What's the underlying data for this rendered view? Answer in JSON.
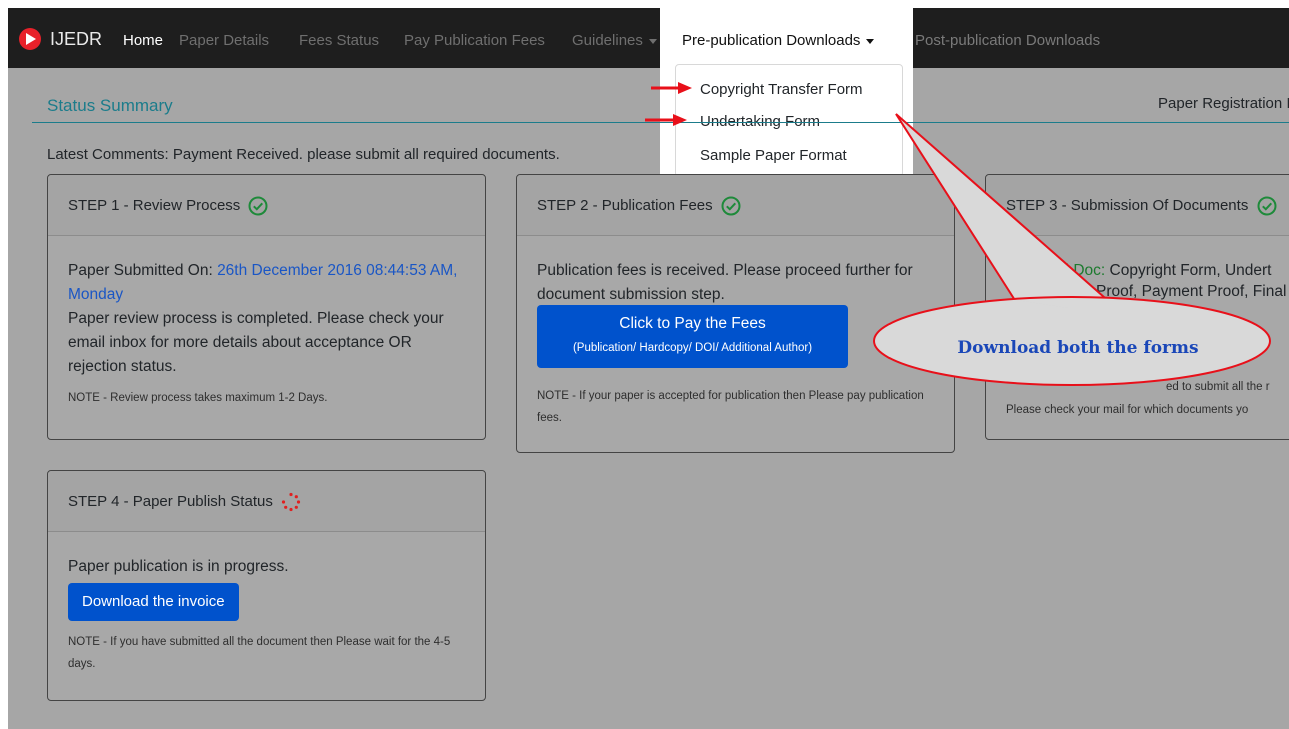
{
  "nav": {
    "brand": "IJEDR",
    "home": "Home",
    "paper_details": "Paper Details",
    "fees_status": "Fees Status",
    "pay_publication_fees": "Pay Publication Fees",
    "guidelines": "Guidelines",
    "pre_publication_downloads": "Pre-publication Downloads",
    "post_publication_downloads": "Post-publication Downloads"
  },
  "dropdown": {
    "items": [
      "Copyright Transfer Form",
      "Undertaking Form",
      "Sample Paper Format"
    ]
  },
  "summary": {
    "title": "Status Summary",
    "registration_label": "Paper Registration I",
    "latest_label": "Latest Comments:",
    "latest_text": "Payment Received. please submit all required documents."
  },
  "steps": {
    "step1": {
      "title": "STEP 1 - Review Process",
      "submitted_label": "Paper Submitted On:",
      "submitted_date": "26th December 2016 08:44:53 AM, Monday",
      "text": "Paper review process is completed. Please check your email inbox for more details about acceptance OR rejection status.",
      "note": "NOTE - Review process takes maximum 1-2 Days."
    },
    "step2": {
      "title": "STEP 2 - Publication Fees",
      "text": "Publication fees is received. Please proceed further for document submission step.",
      "button_line1": "Click to Pay the Fees",
      "button_line2": "(Publication/ Hardcopy/ DOI/ Additional Author)",
      "note": "NOTE - If your paper is accepted for publication then Please pay publication fees."
    },
    "step3": {
      "title": "STEP 3 - Submission Of Documents",
      "received_label": "eived Doc:",
      "received_text": "Copyright Form, Undert",
      "line2": "Proof, Payment Proof, Final Acc",
      "line3": "ed to submit all the r",
      "line4": "Please check your mail for which documents yo"
    },
    "step4": {
      "title": "STEP 4 - Paper Publish Status",
      "text": "Paper publication is in progress.",
      "button": "Download the invoice",
      "note": "NOTE - If you have submitted all the document then Please wait for the 4-5 days."
    }
  },
  "annotation": {
    "callout": "Download both the forms",
    "arrow_color": "#e8101a",
    "callout_fill": "#d9d9d9"
  },
  "colors": {
    "navbar": "#1e1e1e",
    "accent_teal": "#1b7c8b",
    "button_blue": "#0052cc",
    "check_green": "#1e8a3a",
    "spinner_red": "#e02020"
  }
}
